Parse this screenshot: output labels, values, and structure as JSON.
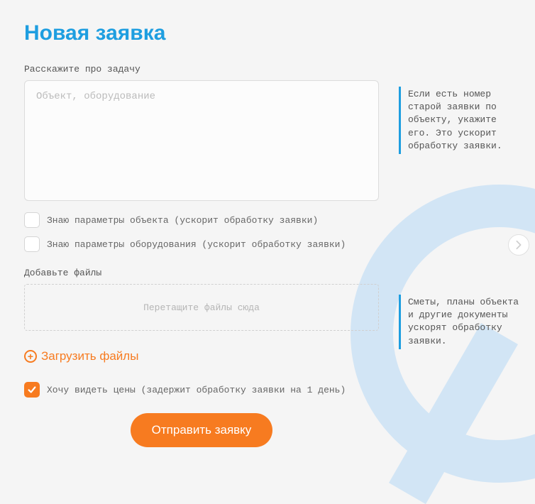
{
  "title": "Новая заявка",
  "task": {
    "label": "Расскажите про задачу",
    "placeholder": "Объект, оборудование"
  },
  "checks": {
    "object_params": "Знаю параметры объекта (ускорит обработку заявки)",
    "equipment_params": "Знаю параметры оборудования (ускорит обработку заявки)"
  },
  "files": {
    "label": "Добавьте файлы",
    "dropzone_text": "Перетащите файлы сюда",
    "upload_label": "Загрузить файлы"
  },
  "prices": {
    "label": "Хочу видеть цены (задержит обработку заявки на 1 день)"
  },
  "submit_label": "Отправить заявку",
  "hints": {
    "task": "Если есть номер старой заявки по объекту, укажите его. Это ускорит обработку заявки.",
    "files": "Сметы, планы объекта и другие документы ускорят обработку заявки."
  }
}
